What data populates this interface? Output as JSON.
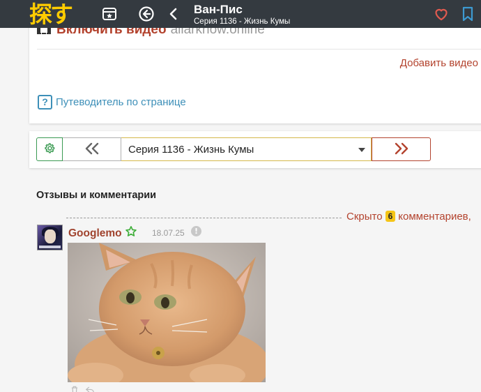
{
  "header": {
    "logo_text": "探す",
    "title": "Ван-Пис",
    "subtitle": "Серия 1136 - Жизнь Кумы",
    "icons": [
      "bookmark-box-icon",
      "back-circle-icon",
      "chevron-left-icon",
      "heart-icon",
      "bookmark-icon"
    ],
    "accent_color": "#e05a4f"
  },
  "video": {
    "link_label": "Включить видео",
    "site": "allarknow.online",
    "add_video_label": "Добавить видео"
  },
  "guide": {
    "icon_text": "?",
    "label": "Путеводитель по странице"
  },
  "episode_nav": {
    "prev_label": "«",
    "next_label": "»",
    "selected_episode": "Серия 1136 - Жизнь Кумы"
  },
  "comments": {
    "title": "Отзывы и комментарии",
    "hidden_prefix": "Скрыто",
    "hidden_count": "6",
    "hidden_suffix": "комментариев,",
    "items": [
      {
        "username": "Googlemo",
        "date": "18.07.25",
        "info_icon_text": "!"
      }
    ]
  },
  "colors": {
    "topbar": "#343a40",
    "link_red": "#b3432e",
    "guide_blue": "#3d8fb8",
    "gear_green": "#3a9a52",
    "badge_yellow": "#f5c518"
  }
}
